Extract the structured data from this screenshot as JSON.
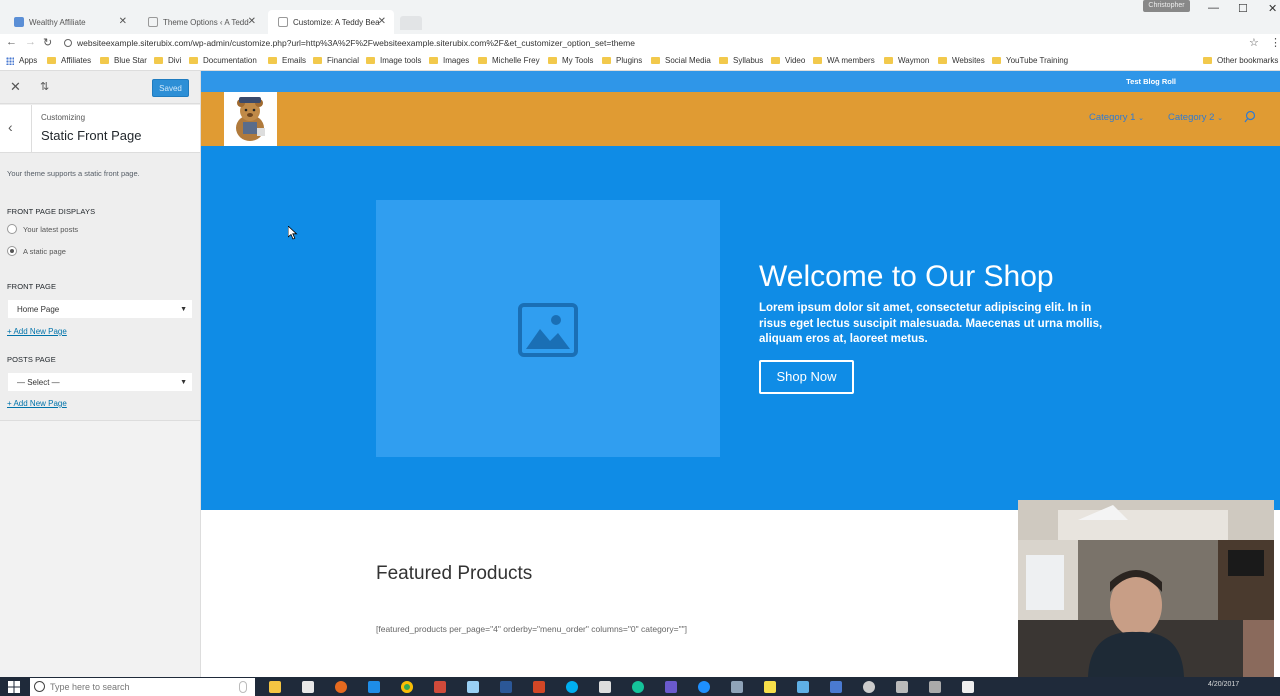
{
  "browser": {
    "tabs": [
      {
        "title": "Wealthy Affiliate",
        "active": false
      },
      {
        "title": "Theme Options ‹ A Tedd",
        "active": false
      },
      {
        "title": "Customize: A Teddy Bea",
        "active": true
      }
    ],
    "user_chip": "Christopher",
    "url": "websiteexample.siterubix.com/wp-admin/customize.php?url=http%3A%2F%2Fwebsiteexample.siterubix.com%2F&et_customizer_option_set=theme",
    "bookmarks": [
      {
        "label": "Apps",
        "type": "apps"
      },
      {
        "label": "Affiliates",
        "type": "folder"
      },
      {
        "label": "Blue Star",
        "type": "folder"
      },
      {
        "label": "Divi",
        "type": "folder"
      },
      {
        "label": "Documentation",
        "type": "folder"
      },
      {
        "label": "Emails",
        "type": "folder"
      },
      {
        "label": "Financial",
        "type": "folder"
      },
      {
        "label": "Image tools",
        "type": "folder"
      },
      {
        "label": "Images",
        "type": "folder"
      },
      {
        "label": "Michelle Frey",
        "type": "folder"
      },
      {
        "label": "My Tools",
        "type": "folder"
      },
      {
        "label": "Plugins",
        "type": "folder"
      },
      {
        "label": "Social Media",
        "type": "folder"
      },
      {
        "label": "Syllabus",
        "type": "folder"
      },
      {
        "label": "Video",
        "type": "folder"
      },
      {
        "label": "WA members",
        "type": "folder"
      },
      {
        "label": "Waymon",
        "type": "folder"
      },
      {
        "label": "Websites",
        "type": "folder"
      },
      {
        "label": "YouTube Training",
        "type": "folder"
      }
    ],
    "other_bookmarks": "Other bookmarks"
  },
  "customizer": {
    "saved_label": "Saved",
    "customizing_label": "Customizing",
    "section_title": "Static Front Page",
    "description": "Your theme supports a static front page.",
    "front_page_displays_label": "Front page displays",
    "radio_options": [
      {
        "label": "Your latest posts",
        "checked": false
      },
      {
        "label": "A static page",
        "checked": true
      }
    ],
    "front_page_label": "Front page",
    "front_page_value": "Home Page",
    "add_new_page_1": "+ Add New Page",
    "posts_page_label": "Posts page",
    "posts_page_value": "— Select —",
    "add_new_page_2": "+ Add New Page"
  },
  "preview": {
    "top_bar_text": "Test Blog Roll",
    "menu": [
      {
        "label": "Category 1"
      },
      {
        "label": "Category 2"
      }
    ],
    "hero": {
      "title": "Welcome to Our Shop",
      "text": "Lorem ipsum dolor sit amet, consectetur adipiscing elit. In in risus eget lectus suscipit malesuada. Maecenas ut urna mollis, aliquam eros at, laoreet metus.",
      "button": "Shop Now"
    },
    "featured_title": "Featured Products",
    "shortcode": "[featured_products per_page=\"4\" orderby=\"menu_order\" columns=\"0\" category=\"\"]"
  },
  "taskbar": {
    "search_placeholder": "Type here to search",
    "clock": "4/20/2017"
  },
  "colors": {
    "accent_blue": "#0f8ce6",
    "header_orange": "#e09b33",
    "menu_link": "#2e7bd4",
    "wp_link": "#0073aa"
  }
}
